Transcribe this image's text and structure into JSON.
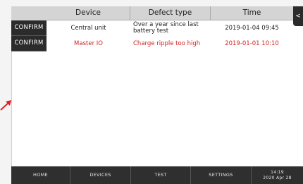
{
  "table": {
    "headers": {
      "device": "Device",
      "defect_type": "Defect type",
      "time": "Time"
    },
    "rows": [
      {
        "action": "CONFIRM",
        "device": "Central unit",
        "defect_type": "Over a year since last battery test",
        "time": "2019-01-04 09:45",
        "color": "#222222"
      },
      {
        "action": "CONFIRM",
        "device": "Master IO",
        "defect_type": "Charge ripple too high",
        "time": "2019-01-01 10:10",
        "color": "#d42020"
      }
    ]
  },
  "side_tab": {
    "label": "<"
  },
  "annotation": {
    "icon": "arrow-icon",
    "color": "#e02020"
  },
  "nav": {
    "home": "HOME",
    "devices": "DEVICES",
    "test": "TEST",
    "settings": "SETTINGS",
    "clock_time": "14:19",
    "clock_date": "2020 Apr 28"
  }
}
